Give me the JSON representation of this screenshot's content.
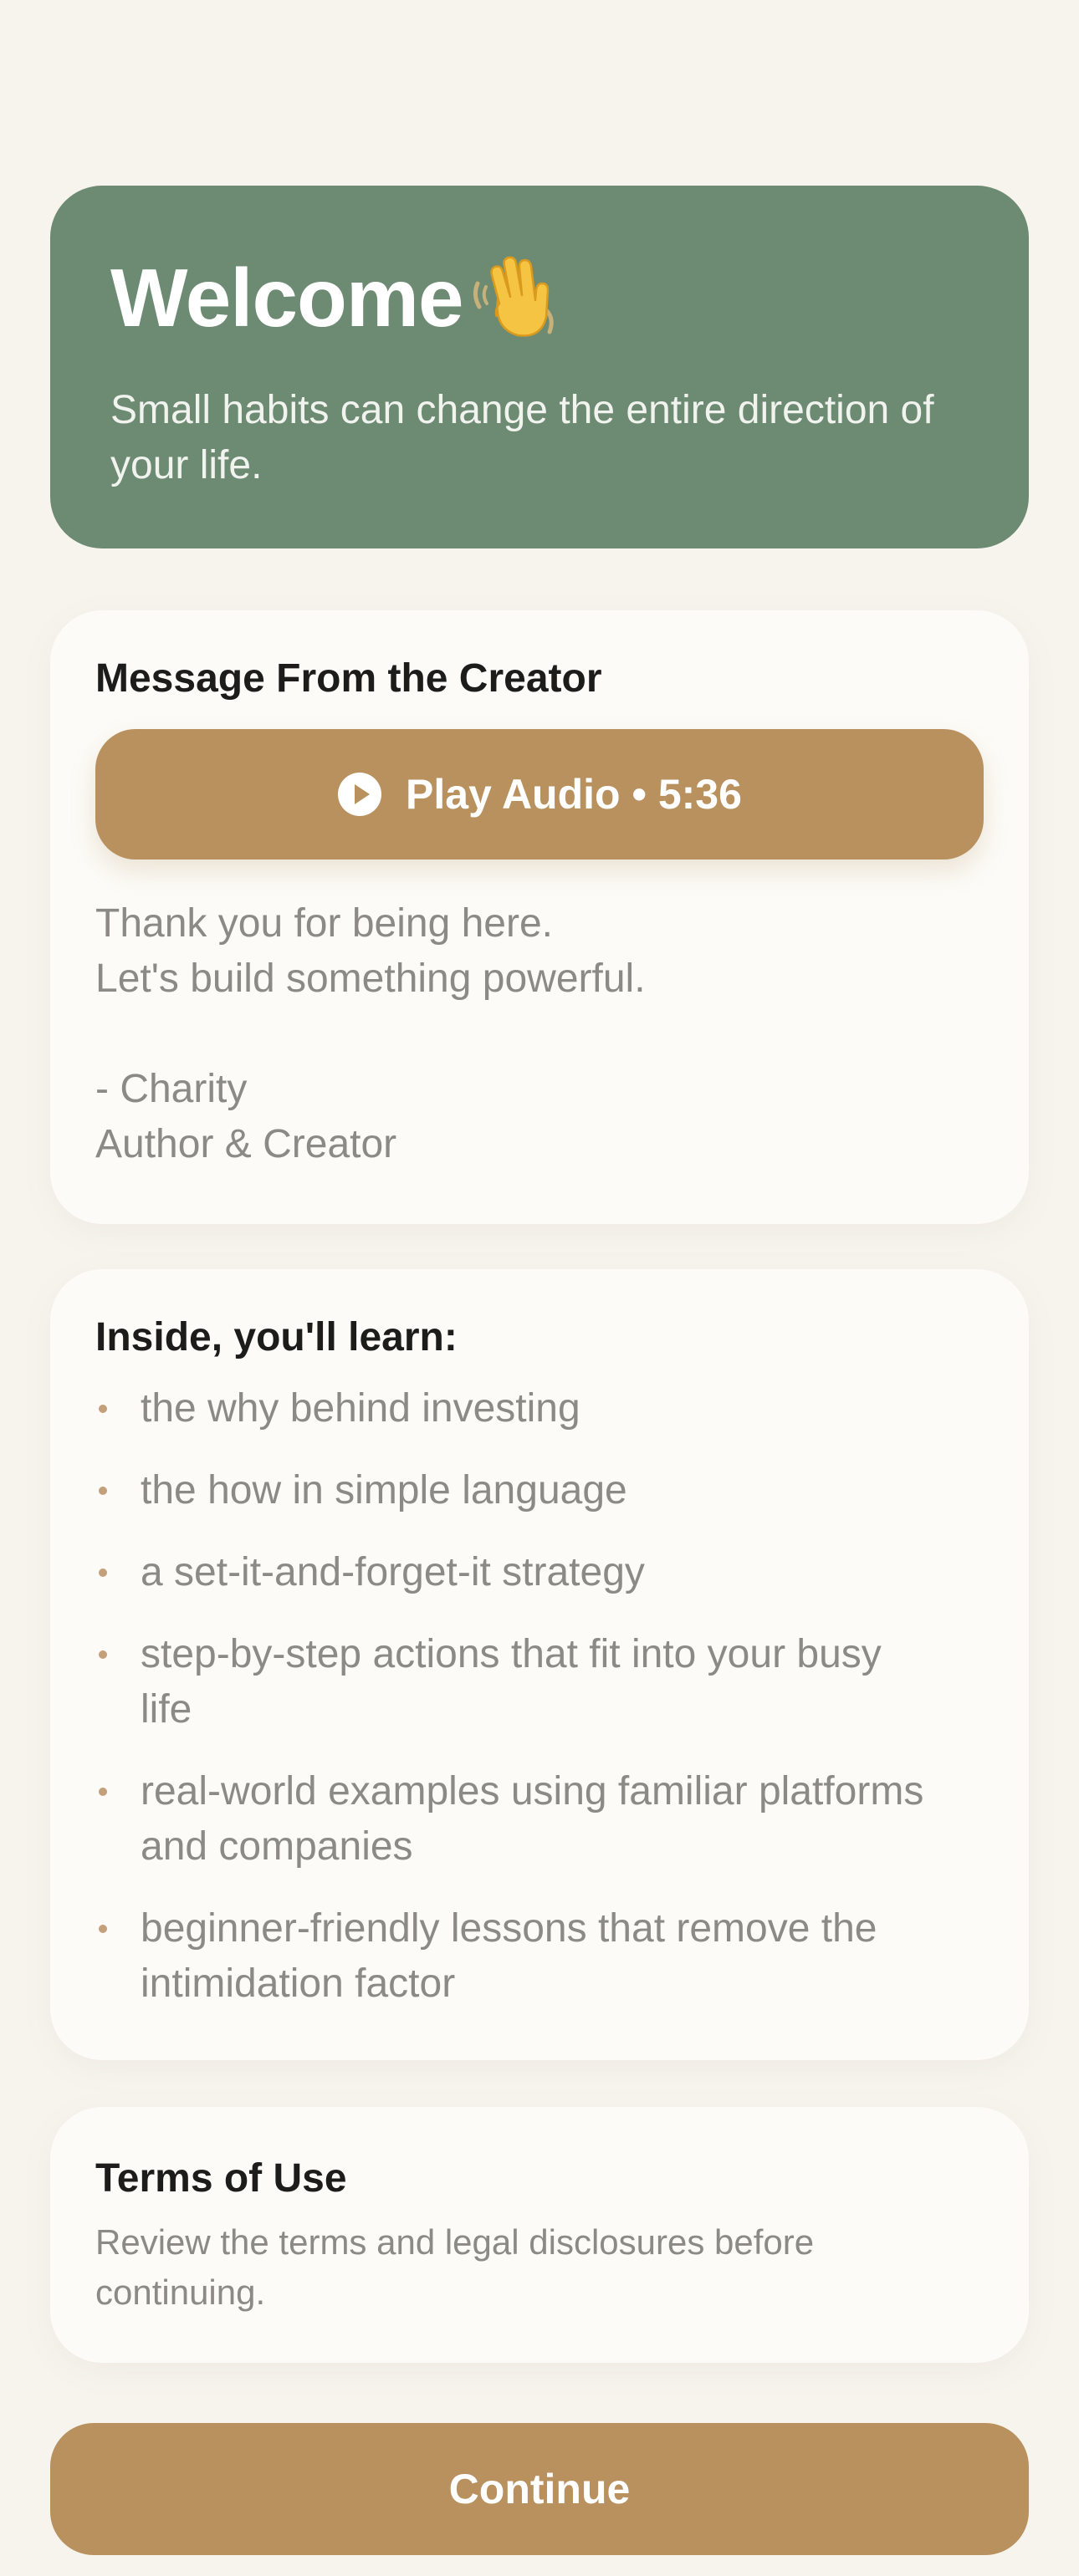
{
  "hero": {
    "title": "Welcome",
    "emoji_icon": "waving-hand-icon",
    "subtitle": "Small habits can change the entire direction of your life.",
    "background": "#6d8a73"
  },
  "creator_message": {
    "title": "Message From the Creator",
    "play_button_label": "Play Audio • 5:36",
    "play_icon": "play-circle-icon",
    "lines": [
      "Thank you for being here.",
      "Let's build something powerful."
    ],
    "signature_name": "- Charity",
    "signature_role": "Author & Creator"
  },
  "learn": {
    "title": "Inside, you'll learn:",
    "items": [
      "the why behind investing",
      "the how in simple language",
      "a set-it-and-forget-it strategy",
      "step-by-step actions that fit into your busy life",
      "real-world examples using familiar platforms and companies",
      "beginner-friendly lessons that remove the intimidation factor"
    ]
  },
  "terms": {
    "title": "Terms of Use",
    "description": "Review the terms and legal disclosures before continuing."
  },
  "continue_button": {
    "label": "Continue"
  },
  "colors": {
    "page_background": "#f7f4ee",
    "card_background": "#fcfbf7",
    "accent_gold": "#b8915e",
    "muted_text": "#8c8a86",
    "heading_text": "#1c1c1a"
  }
}
